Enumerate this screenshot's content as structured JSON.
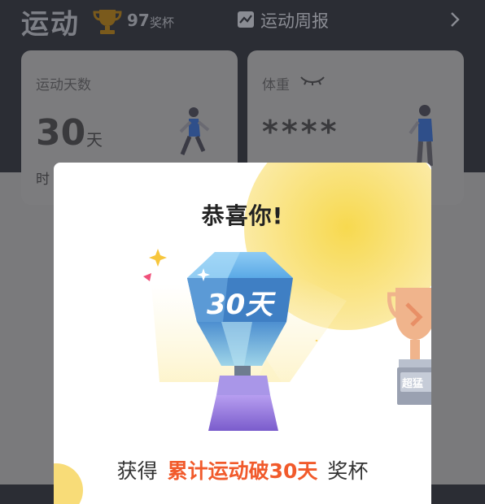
{
  "header": {
    "title": "运动",
    "trophy_count": "97",
    "trophy_unit": "奖杯",
    "weekly_report": "运动周报"
  },
  "cards": {
    "days": {
      "label": "运动天数",
      "value": "30",
      "unit": "天",
      "partial_label": "时"
    },
    "weight": {
      "label": "体重",
      "masked_value": "****"
    }
  },
  "modal": {
    "title": "恭喜你!",
    "trophy_text": "30天",
    "next_trophy_text": "超猛",
    "award_prefix": "获得",
    "award_name": "累计运动破30天",
    "award_suffix": "奖杯"
  },
  "colors": {
    "accent": "#f15a2b",
    "trophy_blue": "#5aa9e6",
    "trophy_base": "#8a6fd1",
    "glow_yellow": "#f8dc78"
  },
  "icons": {
    "trophy_badge": "trophy-icon",
    "weekly": "chart-icon",
    "eye": "eye-closed-icon",
    "chevron": "chevron-right-icon"
  }
}
